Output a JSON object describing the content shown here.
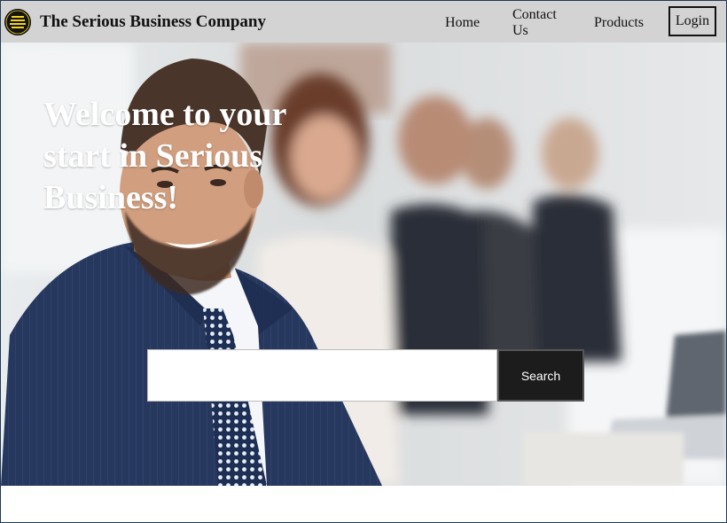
{
  "brand": {
    "name": "The Serious Business Company",
    "logo_text": "THE SERIOUS BUSINESS"
  },
  "nav": {
    "home": "Home",
    "contact": "Contact Us",
    "products": "Products",
    "login": "Login"
  },
  "hero": {
    "title": "Welcome to your start in Serious Business!",
    "image": "business-team-photo"
  },
  "search": {
    "value": "",
    "placeholder": "",
    "button_label": "Search"
  },
  "colors": {
    "navbar_bg": "#d3d3d3",
    "search_button_bg": "#1c1c1c",
    "logo_bg": "#141414",
    "logo_text": "#f2d21b"
  }
}
